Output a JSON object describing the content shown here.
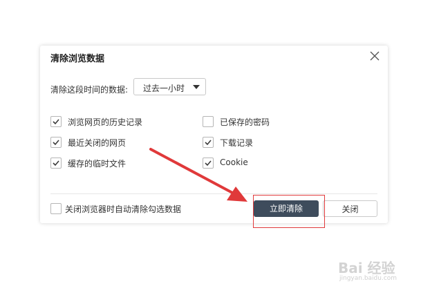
{
  "dialog": {
    "title": "清除浏览数据",
    "close_icon": "close-icon"
  },
  "time_range": {
    "label": "清除这段时间的数据:",
    "selected": "过去一小时"
  },
  "options": [
    {
      "label": "浏览网页的历史记录",
      "checked": true
    },
    {
      "label": "已保存的密码",
      "checked": false
    },
    {
      "label": "最近关闭的网页",
      "checked": true
    },
    {
      "label": "下载记录",
      "checked": true
    },
    {
      "label": "缓存的临时文件",
      "checked": true
    },
    {
      "label": "Cookie",
      "checked": true
    }
  ],
  "footer": {
    "auto_clear_label": "关闭浏览器时自动清除勾选数据",
    "auto_clear_checked": false,
    "clear_now_label": "立即清除",
    "close_label": "关闭"
  },
  "annotation": {
    "color": "#e0393a"
  },
  "watermark": {
    "main": "Bai 经验",
    "sub": "jingyan.baidu.com"
  },
  "colors": {
    "primary_button": "#3e4c5c",
    "check_mark": "#3a3a3a"
  }
}
